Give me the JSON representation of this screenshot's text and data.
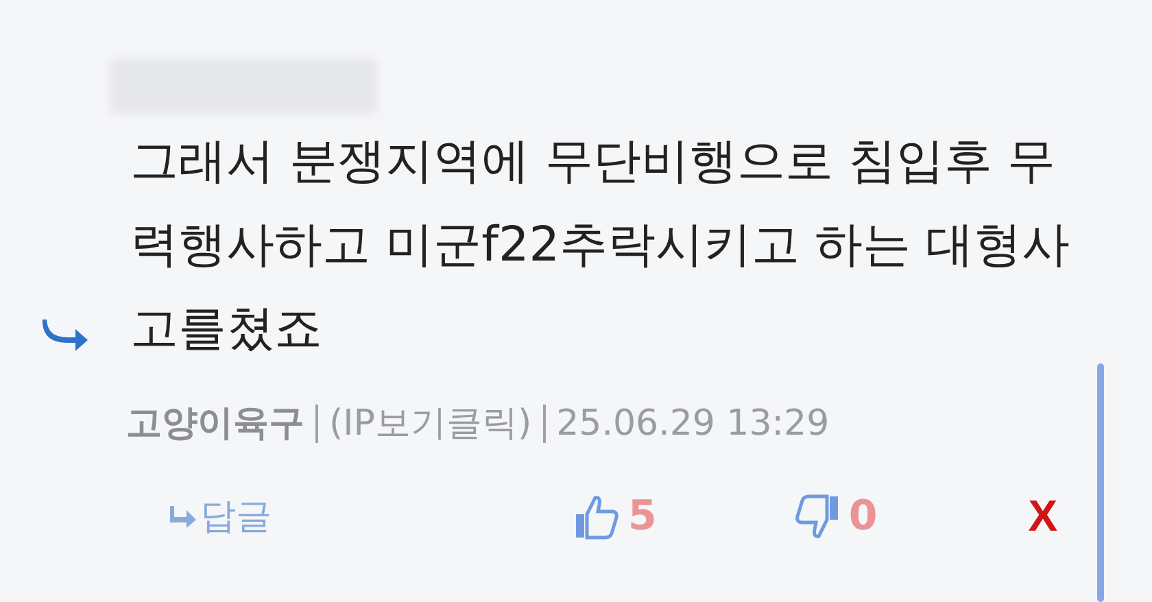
{
  "comment": {
    "text": "그래서 분쟁지역에 무단비행으로 침입후 무력행사하고 미군f22추락시키고 하는 대형사고를쳤죠",
    "author": "고양이육구",
    "ip_link": "(IP보기클릭)",
    "timestamp": "25.06.29 13:29"
  },
  "actions": {
    "reply": "답글",
    "likes": "5",
    "dislikes": "0",
    "delete": "X"
  }
}
